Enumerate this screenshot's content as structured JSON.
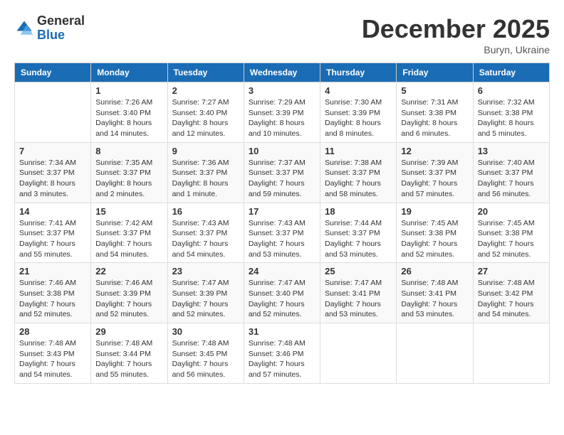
{
  "logo": {
    "general": "General",
    "blue": "Blue"
  },
  "title": "December 2025",
  "location": "Buryn, Ukraine",
  "weekdays": [
    "Sunday",
    "Monday",
    "Tuesday",
    "Wednesday",
    "Thursday",
    "Friday",
    "Saturday"
  ],
  "weeks": [
    [
      {
        "day": "",
        "info": ""
      },
      {
        "day": "1",
        "info": "Sunrise: 7:26 AM\nSunset: 3:40 PM\nDaylight: 8 hours\nand 14 minutes."
      },
      {
        "day": "2",
        "info": "Sunrise: 7:27 AM\nSunset: 3:40 PM\nDaylight: 8 hours\nand 12 minutes."
      },
      {
        "day": "3",
        "info": "Sunrise: 7:29 AM\nSunset: 3:39 PM\nDaylight: 8 hours\nand 10 minutes."
      },
      {
        "day": "4",
        "info": "Sunrise: 7:30 AM\nSunset: 3:39 PM\nDaylight: 8 hours\nand 8 minutes."
      },
      {
        "day": "5",
        "info": "Sunrise: 7:31 AM\nSunset: 3:38 PM\nDaylight: 8 hours\nand 6 minutes."
      },
      {
        "day": "6",
        "info": "Sunrise: 7:32 AM\nSunset: 3:38 PM\nDaylight: 8 hours\nand 5 minutes."
      }
    ],
    [
      {
        "day": "7",
        "info": "Sunrise: 7:34 AM\nSunset: 3:37 PM\nDaylight: 8 hours\nand 3 minutes."
      },
      {
        "day": "8",
        "info": "Sunrise: 7:35 AM\nSunset: 3:37 PM\nDaylight: 8 hours\nand 2 minutes."
      },
      {
        "day": "9",
        "info": "Sunrise: 7:36 AM\nSunset: 3:37 PM\nDaylight: 8 hours\nand 1 minute."
      },
      {
        "day": "10",
        "info": "Sunrise: 7:37 AM\nSunset: 3:37 PM\nDaylight: 7 hours\nand 59 minutes."
      },
      {
        "day": "11",
        "info": "Sunrise: 7:38 AM\nSunset: 3:37 PM\nDaylight: 7 hours\nand 58 minutes."
      },
      {
        "day": "12",
        "info": "Sunrise: 7:39 AM\nSunset: 3:37 PM\nDaylight: 7 hours\nand 57 minutes."
      },
      {
        "day": "13",
        "info": "Sunrise: 7:40 AM\nSunset: 3:37 PM\nDaylight: 7 hours\nand 56 minutes."
      }
    ],
    [
      {
        "day": "14",
        "info": "Sunrise: 7:41 AM\nSunset: 3:37 PM\nDaylight: 7 hours\nand 55 minutes."
      },
      {
        "day": "15",
        "info": "Sunrise: 7:42 AM\nSunset: 3:37 PM\nDaylight: 7 hours\nand 54 minutes."
      },
      {
        "day": "16",
        "info": "Sunrise: 7:43 AM\nSunset: 3:37 PM\nDaylight: 7 hours\nand 54 minutes."
      },
      {
        "day": "17",
        "info": "Sunrise: 7:43 AM\nSunset: 3:37 PM\nDaylight: 7 hours\nand 53 minutes."
      },
      {
        "day": "18",
        "info": "Sunrise: 7:44 AM\nSunset: 3:37 PM\nDaylight: 7 hours\nand 53 minutes."
      },
      {
        "day": "19",
        "info": "Sunrise: 7:45 AM\nSunset: 3:38 PM\nDaylight: 7 hours\nand 52 minutes."
      },
      {
        "day": "20",
        "info": "Sunrise: 7:45 AM\nSunset: 3:38 PM\nDaylight: 7 hours\nand 52 minutes."
      }
    ],
    [
      {
        "day": "21",
        "info": "Sunrise: 7:46 AM\nSunset: 3:38 PM\nDaylight: 7 hours\nand 52 minutes."
      },
      {
        "day": "22",
        "info": "Sunrise: 7:46 AM\nSunset: 3:39 PM\nDaylight: 7 hours\nand 52 minutes."
      },
      {
        "day": "23",
        "info": "Sunrise: 7:47 AM\nSunset: 3:39 PM\nDaylight: 7 hours\nand 52 minutes."
      },
      {
        "day": "24",
        "info": "Sunrise: 7:47 AM\nSunset: 3:40 PM\nDaylight: 7 hours\nand 52 minutes."
      },
      {
        "day": "25",
        "info": "Sunrise: 7:47 AM\nSunset: 3:41 PM\nDaylight: 7 hours\nand 53 minutes."
      },
      {
        "day": "26",
        "info": "Sunrise: 7:48 AM\nSunset: 3:41 PM\nDaylight: 7 hours\nand 53 minutes."
      },
      {
        "day": "27",
        "info": "Sunrise: 7:48 AM\nSunset: 3:42 PM\nDaylight: 7 hours\nand 54 minutes."
      }
    ],
    [
      {
        "day": "28",
        "info": "Sunrise: 7:48 AM\nSunset: 3:43 PM\nDaylight: 7 hours\nand 54 minutes."
      },
      {
        "day": "29",
        "info": "Sunrise: 7:48 AM\nSunset: 3:44 PM\nDaylight: 7 hours\nand 55 minutes."
      },
      {
        "day": "30",
        "info": "Sunrise: 7:48 AM\nSunset: 3:45 PM\nDaylight: 7 hours\nand 56 minutes."
      },
      {
        "day": "31",
        "info": "Sunrise: 7:48 AM\nSunset: 3:46 PM\nDaylight: 7 hours\nand 57 minutes."
      },
      {
        "day": "",
        "info": ""
      },
      {
        "day": "",
        "info": ""
      },
      {
        "day": "",
        "info": ""
      }
    ]
  ]
}
